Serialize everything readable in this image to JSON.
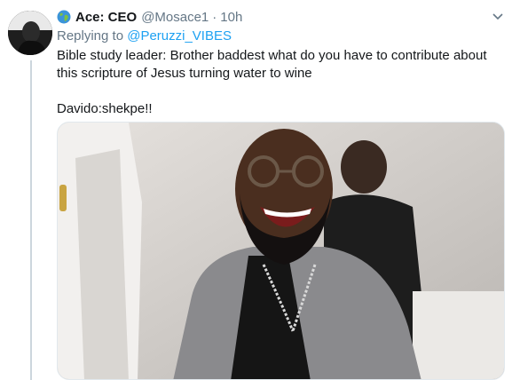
{
  "tweet": {
    "author_name": "Ace: CEO",
    "author_handle": "@Mosace1",
    "separator": "·",
    "timestamp": "10h",
    "reply_prefix": "Replying to",
    "reply_handle": "@Peruzzi_VIBES",
    "text_line1": "Bible study leader: Brother baddest what do you have to contribute about this scripture of Jesus turning water to wine",
    "text_line2": "Davido:shekpe!!",
    "icons": {
      "flag": "globe-icon",
      "menu": "chevron-down-icon"
    },
    "media_alt": "photo",
    "colors": {
      "link": "#1da1f2",
      "secondary": "#657786",
      "text": "#14171a"
    }
  }
}
